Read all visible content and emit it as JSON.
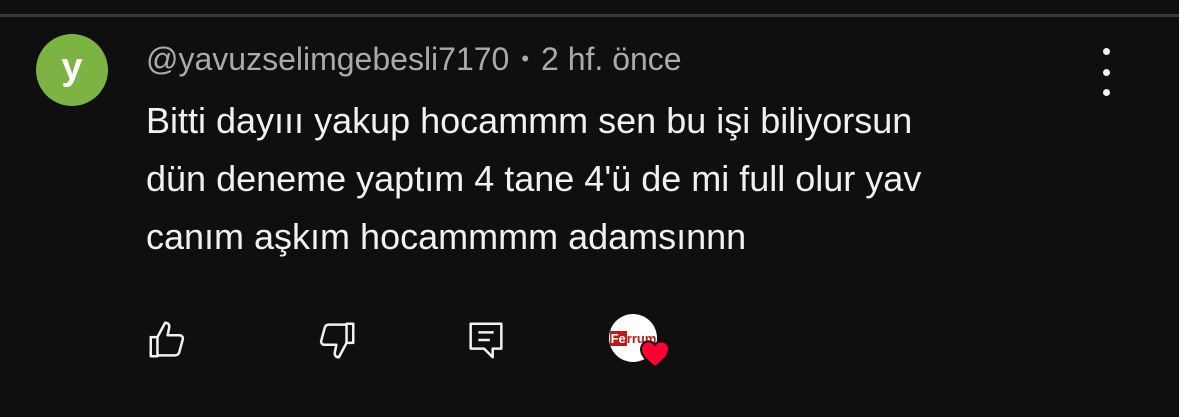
{
  "comment": {
    "avatar_letter": "y",
    "avatar_color": "#7cb342",
    "author": "@yavuzselimgebesli7170",
    "separator": "•",
    "timestamp": "2 hf. önce",
    "text_lines": [
      "Bitti dayııı yakup hocammm sen bu işi biliyorsun",
      "dün deneme yaptım 4 tane 4'ü de mi full olur yav",
      "canım aşkım hocammmm adamsınnn"
    ]
  },
  "actions": {
    "like_icon": "thumb-up-icon",
    "dislike_icon": "thumb-down-icon",
    "reply_icon": "reply-comment-icon",
    "creator_heart": {
      "logo_text_box": "Fe",
      "logo_text_rest": "rrum",
      "heart_color": "#ff0033"
    }
  }
}
